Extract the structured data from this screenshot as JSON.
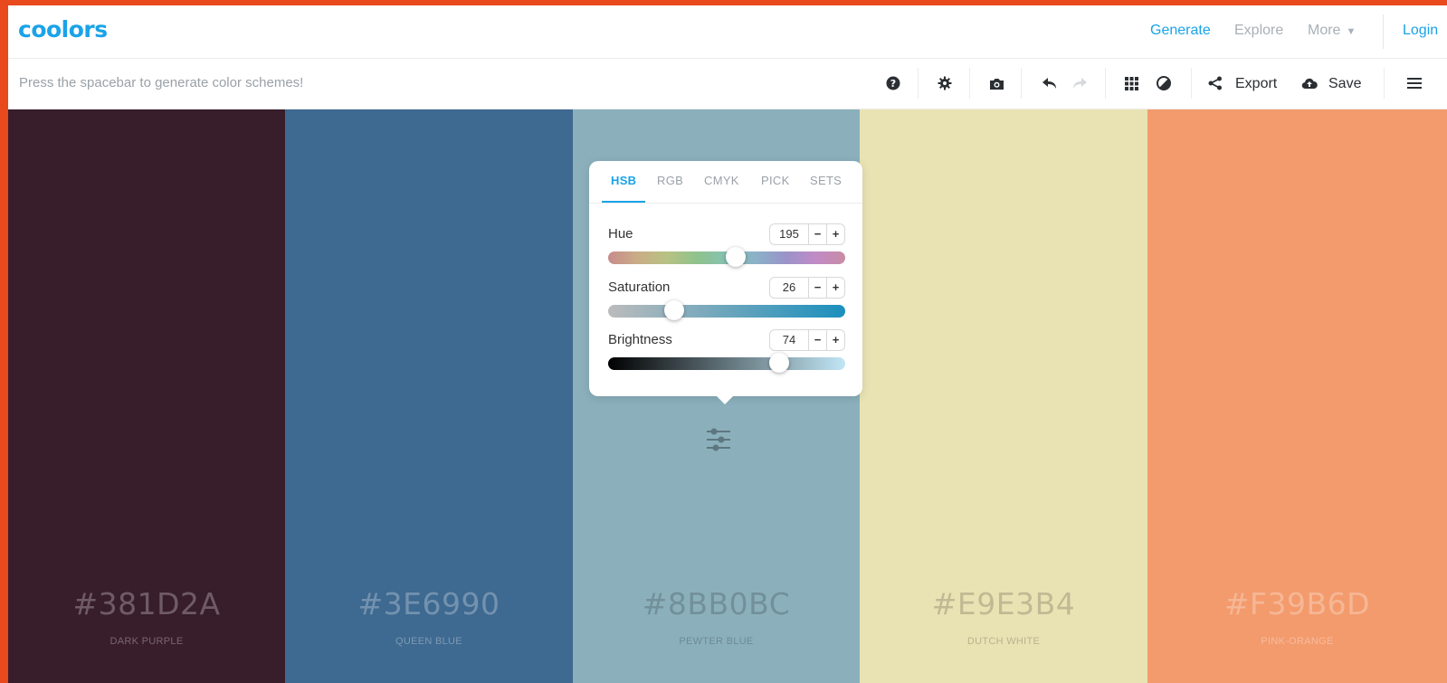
{
  "logo": "coolors",
  "nav": {
    "generate": "Generate",
    "explore": "Explore",
    "more": "More",
    "login": "Login"
  },
  "toolbar": {
    "hint": "Press the spacebar to generate color schemes!",
    "export_label": "Export",
    "save_label": "Save",
    "icons": [
      "help-icon",
      "settings-icon",
      "camera-icon",
      "undo-icon",
      "redo-icon",
      "grid-view-icon",
      "contrast-icon",
      "share-icon",
      "cloud-upload-icon",
      "hamburger-menu-icon"
    ]
  },
  "palette": [
    {
      "hex": "#381D2A",
      "name": "DARK PURPLE",
      "color": "#381d2a"
    },
    {
      "hex": "#3E6990",
      "name": "QUEEN BLUE",
      "color": "#3e6990"
    },
    {
      "hex": "#8BB0BC",
      "name": "PEWTER BLUE",
      "color": "#8bb0bc"
    },
    {
      "hex": "#E9E3B4",
      "name": "DUTCH WHITE",
      "color": "#e9e3b4"
    },
    {
      "hex": "#F39B6D",
      "name": "PINK-ORANGE",
      "color": "#f39b6d"
    }
  ],
  "panel": {
    "tabs": [
      "HSB",
      "RGB",
      "CMYK",
      "PICK",
      "SETS"
    ],
    "active_tab": "HSB",
    "hue": {
      "label": "Hue",
      "value": "195",
      "fraction": 0.54
    },
    "saturation": {
      "label": "Saturation",
      "value": "26",
      "fraction": 0.28
    },
    "brightness": {
      "label": "Brightness",
      "value": "74",
      "fraction": 0.72
    },
    "minus": "−",
    "plus": "+"
  },
  "colors": {
    "accent": "#1aa3e8",
    "frame": "#e8491d"
  }
}
